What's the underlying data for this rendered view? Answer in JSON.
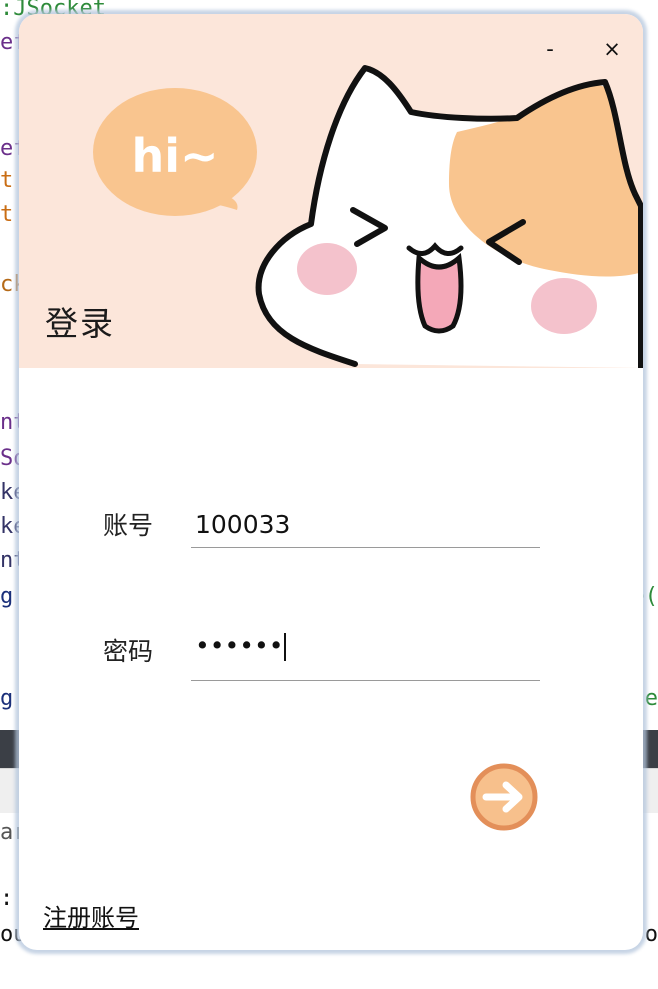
{
  "background_editor": {
    "left_fragments": [
      {
        "text": ":JSocket",
        "color": "#2e8b3a"
      },
      {
        "text": "ef",
        "color": "#6a2f8a"
      },
      {
        "text": "",
        "color": "#333"
      },
      {
        "text": "",
        "color": "#333"
      },
      {
        "text": "ef",
        "color": "#6a2f8a"
      },
      {
        "text": "t",
        "color": "#c96d14"
      },
      {
        "text": "t",
        "color": "#c96d14"
      },
      {
        "text": "",
        "color": "#333"
      },
      {
        "text": "ck",
        "color": "#b56a18"
      },
      {
        "text": "",
        "color": "#333"
      },
      {
        "text": "",
        "color": "#333"
      },
      {
        "text": "",
        "color": "#333"
      },
      {
        "text": "",
        "color": "#333"
      },
      {
        "text": "",
        "color": "#333"
      },
      {
        "text": "",
        "color": "#333"
      },
      {
        "text": "nt",
        "color": "#6a2f8a"
      },
      {
        "text": "So",
        "color": "#6a2f8a"
      },
      {
        "text": "ke",
        "color": "#333366"
      },
      {
        "text": "ke",
        "color": "#333366"
      },
      {
        "text": "nt",
        "color": "#333366"
      },
      {
        "text": "g",
        "color": "#1a2f7a"
      }
    ],
    "lower_fragments": [
      {
        "text": "g",
        "color": "#1a2f7a"
      },
      {
        "text": "",
        "color": "#333"
      },
      {
        "text": "",
        "color": "#333"
      },
      {
        "text": "ar",
        "color": "#555"
      },
      {
        "text": ":",
        "color": "#111"
      },
      {
        "text": "ou",
        "color": "#111"
      }
    ],
    "right_fragments": [
      {
        "text": "e(",
        "color": "#2e8b3a"
      },
      {
        "text": "e",
        "color": "#2e8b3a"
      },
      {
        "text": "o",
        "color": "#111"
      }
    ],
    "bar_color": "#3b3f46"
  },
  "dialog": {
    "minimize_label": "-",
    "close_label": "×",
    "title": "登录",
    "speech_bubble_text": "hi~",
    "account_label": "账号",
    "account_value": "100033",
    "password_label": "密码",
    "password_mask": "••••••",
    "register_link": "注册账号",
    "submit_icon": "arrow-right-icon",
    "colors": {
      "banner": "#fce6da",
      "bubble": "#f9c58f",
      "cat_patch": "#f9c58f",
      "cheek": "#f4c2cc",
      "submit_fill": "#f7c08c",
      "submit_ring": "#e38f59"
    }
  }
}
